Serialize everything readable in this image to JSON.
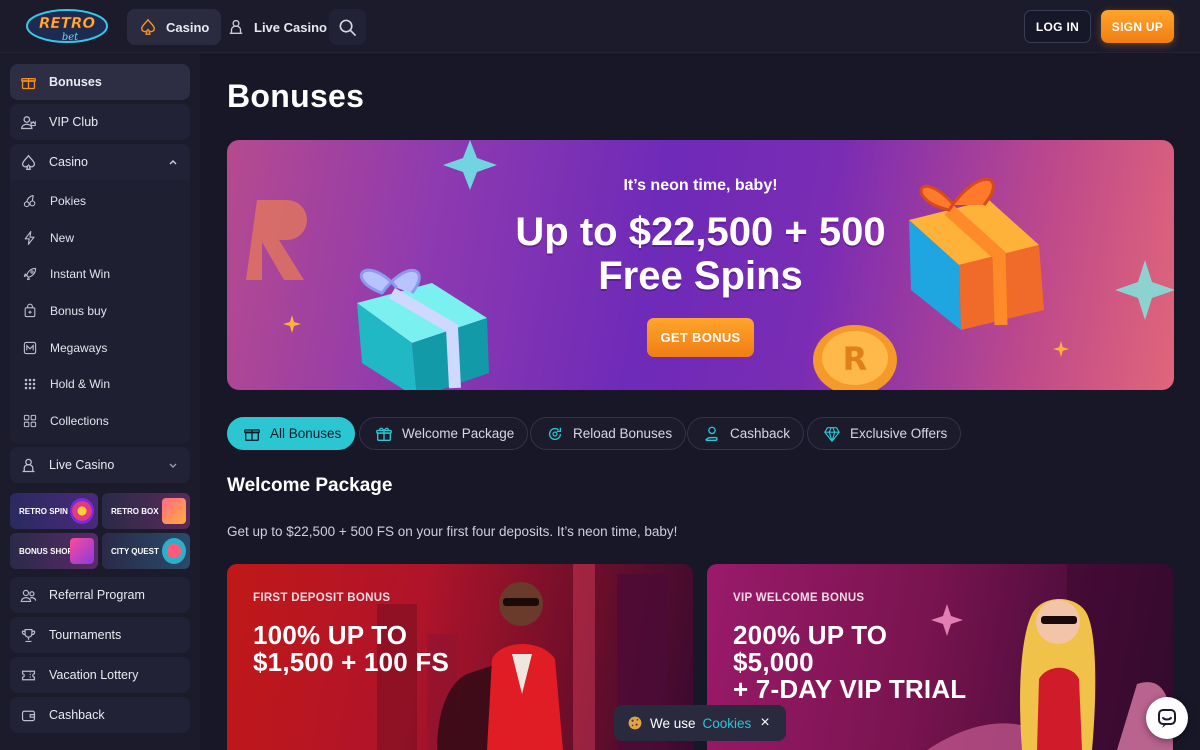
{
  "brand": {
    "logo_text_top": "RETRO",
    "logo_text_bottom": "bet"
  },
  "top_nav": {
    "tabs": [
      {
        "label": "Casino",
        "icon": "spade-icon",
        "active": true
      },
      {
        "label": "Live Casino",
        "icon": "dealer-icon",
        "active": false
      }
    ],
    "search_icon": "search-icon",
    "login_label": "LOG IN",
    "signup_label": "SIGN UP"
  },
  "sidebar": {
    "items": [
      {
        "label": "Bonuses",
        "icon": "gift-icon",
        "active": true
      },
      {
        "label": "VIP Club",
        "icon": "vip-user-icon"
      },
      {
        "label": "Casino",
        "icon": "spade-icon",
        "expanded": true
      },
      {
        "label": "Live Casino",
        "icon": "dealer-icon",
        "expanded": false
      },
      {
        "label": "Referral Program",
        "icon": "users-icon"
      },
      {
        "label": "Tournaments",
        "icon": "trophy-icon"
      },
      {
        "label": "Vacation Lottery",
        "icon": "ticket-icon"
      },
      {
        "label": "Cashback",
        "icon": "wallet-icon"
      }
    ],
    "casino_sub": [
      {
        "label": "Pokies",
        "icon": "cherries-icon"
      },
      {
        "label": "New",
        "icon": "lightning-icon"
      },
      {
        "label": "Instant Win",
        "icon": "rocket-icon"
      },
      {
        "label": "Bonus buy",
        "icon": "bonus-buy-icon"
      },
      {
        "label": "Megaways",
        "icon": "megaways-icon"
      },
      {
        "label": "Hold & Win",
        "icon": "hold-win-icon"
      },
      {
        "label": "Collections",
        "icon": "grid-icon"
      }
    ],
    "promos": [
      {
        "label": "RETRO SPIN"
      },
      {
        "label": "RETRO BOX"
      },
      {
        "label": "BONUS SHOP"
      },
      {
        "label": "CITY QUEST"
      }
    ]
  },
  "main": {
    "page_title": "Bonuses",
    "hero": {
      "kicker": "It’s neon time, baby!",
      "title": "Up to $22,500 + 500\nFree Spins",
      "button": "GET BONUS"
    },
    "filters": [
      {
        "label": "All Bonuses",
        "icon": "gift-icon",
        "active": true
      },
      {
        "label": "Welcome Package",
        "icon": "gift-open-icon"
      },
      {
        "label": "Reload Bonuses",
        "icon": "reload-icon"
      },
      {
        "label": "Cashback",
        "icon": "cashback-icon"
      },
      {
        "label": "Exclusive Offers",
        "icon": "diamond-icon"
      }
    ],
    "section_title": "Welcome Package",
    "section_desc": "Get up to $22,500 + 500 FS on your first four deposits. It’s neon time, baby!",
    "cards": [
      {
        "kicker": "FIRST DEPOSIT BONUS",
        "title": "100% UP TO\n$1,500 + 100 FS"
      },
      {
        "kicker": "VIP WELCOME BONUS",
        "title": "200% UP TO\n$5,000\n+ 7-DAY VIP TRIAL"
      }
    ]
  },
  "cookie": {
    "text": "We use",
    "link": "Cookies",
    "close": "×"
  },
  "chat": {
    "icon": "chat-icon"
  },
  "colors": {
    "accent_orange": "#f5901e",
    "accent_cyan": "#2cc6d3",
    "bg": "#171727",
    "panel": "#1b1b2c"
  }
}
